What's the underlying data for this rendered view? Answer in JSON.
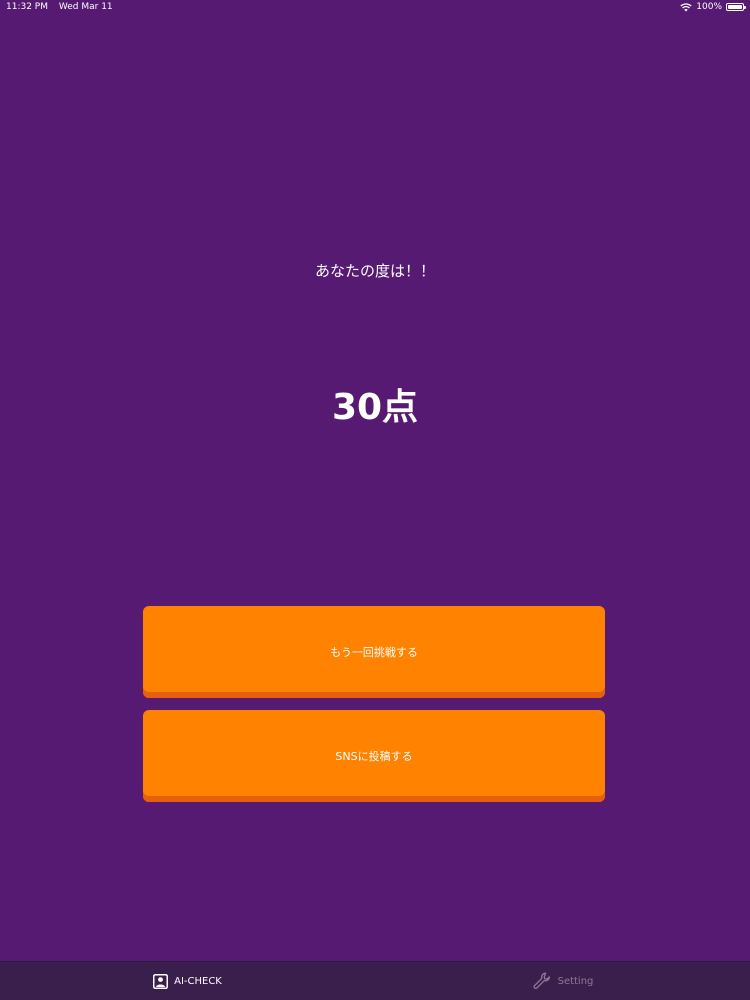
{
  "status_bar": {
    "time": "11:32 PM",
    "date": "Wed Mar 11",
    "battery_text": "100%",
    "battery_level": 1.0,
    "wifi_icon": "wifi-icon",
    "battery_icon": "battery-icon"
  },
  "result": {
    "subtitle": "あなたの度は！！",
    "score": "30点"
  },
  "buttons": {
    "retry_label": "もう一回挑戦する",
    "post_label": "SNSに投稿する"
  },
  "tab_bar": {
    "tabs": [
      {
        "label": "AI-CHECK",
        "icon": "person-portrait-icon",
        "active": true
      },
      {
        "label": "Setting",
        "icon": "wrench-icon",
        "active": false
      }
    ]
  },
  "colors": {
    "background": "#561a72",
    "button": "#ff8200",
    "button_shadow": "#e55f0d",
    "tab_bar": "#3a1f4c",
    "tab_inactive": "#8d7a98"
  }
}
